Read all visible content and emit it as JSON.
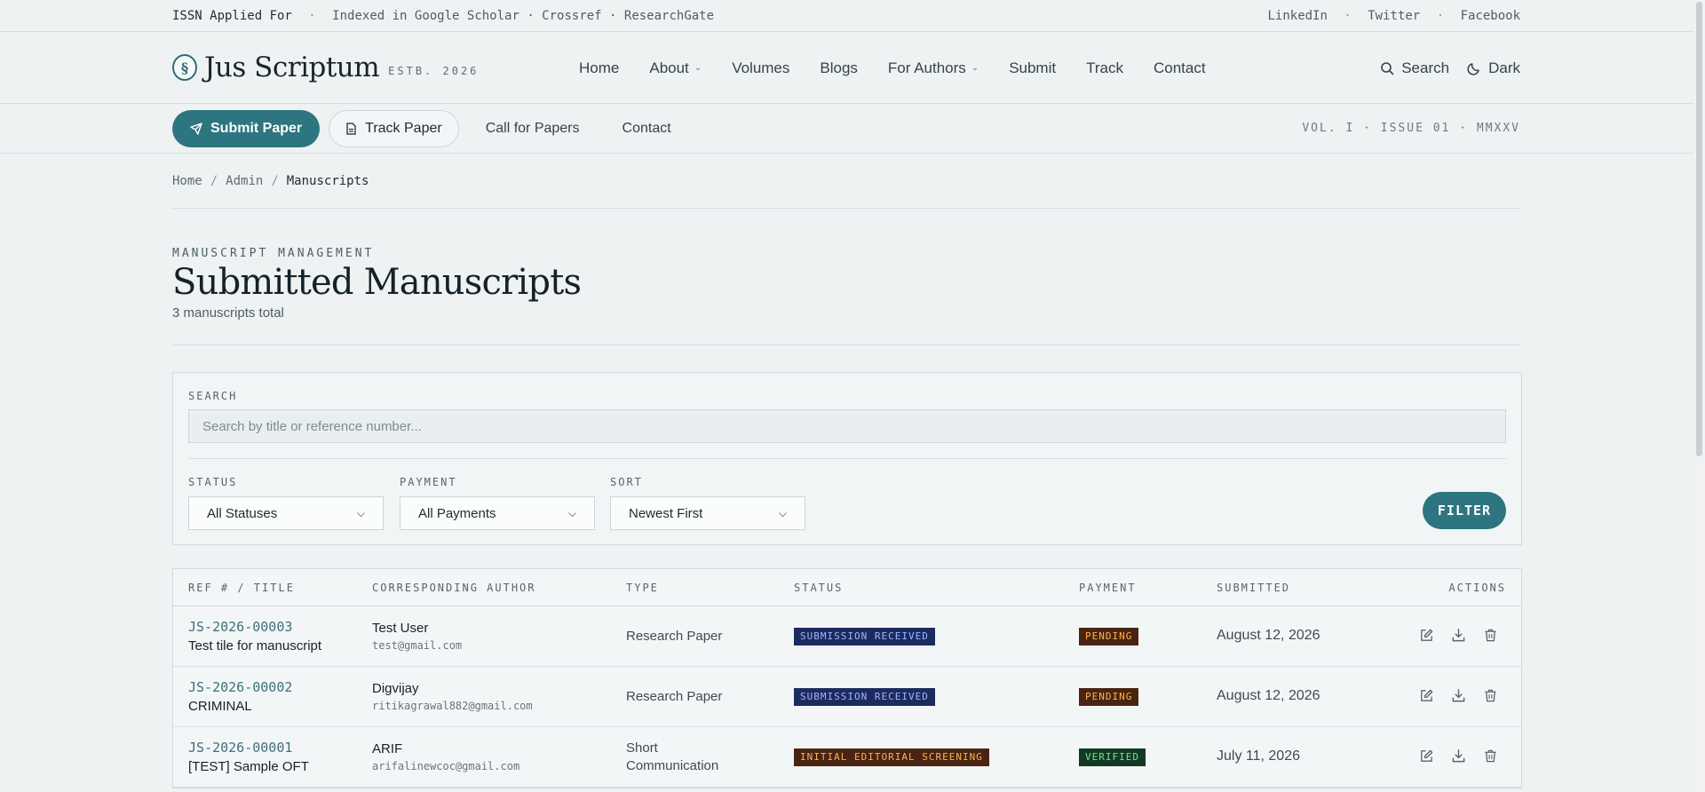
{
  "topbar": {
    "issn": "ISSN Applied For",
    "indexed": "Indexed in Google Scholar · Crossref · ResearchGate",
    "social": [
      "LinkedIn",
      "Twitter",
      "Facebook"
    ]
  },
  "header": {
    "logo_name": "Jus Scriptum",
    "logo_estb": "ESTB. 2026",
    "nav": [
      {
        "label": "Home",
        "has_menu": false
      },
      {
        "label": "About",
        "has_menu": true
      },
      {
        "label": "Volumes",
        "has_menu": false
      },
      {
        "label": "Blogs",
        "has_menu": false
      },
      {
        "label": "For Authors",
        "has_menu": true
      },
      {
        "label": "Submit",
        "has_menu": false
      },
      {
        "label": "Track",
        "has_menu": false
      },
      {
        "label": "Contact",
        "has_menu": false
      }
    ],
    "search_label": "Search",
    "theme_label": "Dark"
  },
  "actionbar": {
    "submit_label": "Submit Paper",
    "track_label": "Track Paper",
    "call_label": "Call for Papers",
    "contact_label": "Contact",
    "volume_info": "VOL. I · ISSUE 01 · MMXXV"
  },
  "breadcrumb": [
    "Home",
    "Admin",
    "Manuscripts"
  ],
  "page": {
    "eyebrow": "MANUSCRIPT MANAGEMENT",
    "title": "Submitted Manuscripts",
    "subtitle": "3 manuscripts total"
  },
  "filters": {
    "search_label": "SEARCH",
    "search_placeholder": "Search by title or reference number...",
    "status_label": "STATUS",
    "status_value": "All Statuses",
    "payment_label": "PAYMENT",
    "payment_value": "All Payments",
    "sort_label": "SORT",
    "sort_value": "Newest First",
    "filter_button": "FILTER"
  },
  "table": {
    "headers": [
      "REF # / TITLE",
      "CORRESPONDING AUTHOR",
      "TYPE",
      "STATUS",
      "PAYMENT",
      "SUBMITTED",
      "ACTIONS"
    ],
    "rows": [
      {
        "ref": "JS-2026-00003",
        "title": "Test tile for manuscript",
        "author": "Test User",
        "email": "test@gmail.com",
        "type": "Research Paper",
        "status": "SUBMISSION RECEIVED",
        "status_bg": "#1c2b5e",
        "status_fg": "#9fb4ff",
        "payment": "PENDING",
        "payment_bg": "#4a2412",
        "payment_fg": "#ffb347",
        "date": "August 12, 2026"
      },
      {
        "ref": "JS-2026-00002",
        "title": "CRIMINAL",
        "author": "Digvijay",
        "email": "ritikagrawal882@gmail.com",
        "type": "Research Paper",
        "status": "SUBMISSION RECEIVED",
        "status_bg": "#1c2b5e",
        "status_fg": "#9fb4ff",
        "payment": "PENDING",
        "payment_bg": "#4a2412",
        "payment_fg": "#ffb347",
        "date": "August 12, 2026"
      },
      {
        "ref": "JS-2026-00001",
        "title": "[TEST] Sample OFT",
        "author": "ARIF",
        "email": "arifalinewcoc@gmail.com",
        "type": "Short Communication",
        "status": "INITIAL EDITORIAL SCREENING",
        "status_bg": "#4a2412",
        "status_fg": "#ffb347",
        "payment": "VERIFIED",
        "payment_bg": "#123a22",
        "payment_fg": "#6ee29a",
        "date": "July 11, 2026"
      }
    ]
  },
  "colors": {
    "accent": "#2d7580",
    "background": "#eef2f3"
  }
}
